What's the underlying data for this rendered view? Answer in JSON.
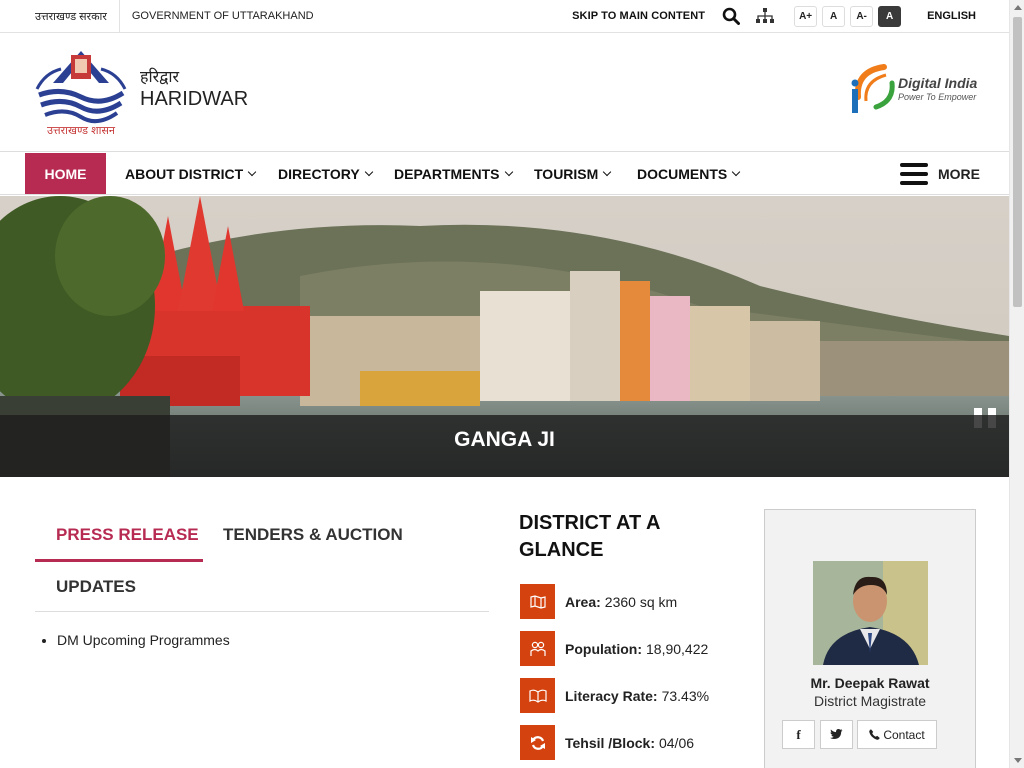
{
  "topbar": {
    "gov_hindi": "उत्तराखण्ड सरकार",
    "gov_english": "GOVERNMENT OF UTTARAKHAND",
    "skip_link": "SKIP TO MAIN CONTENT",
    "font_sizes": [
      "A+",
      "A",
      "A-",
      "A"
    ],
    "language": "ENGLISH",
    "icons": [
      "search-icon",
      "sitemap-icon"
    ]
  },
  "header": {
    "emblem_caption": "उत्तराखण्ड शासन",
    "title_hindi": "हरिद्वार",
    "title_english": "HARIDWAR",
    "digital_india_title": "Digital India",
    "digital_india_tagline": "Power To Empower"
  },
  "nav": {
    "items": [
      "HOME",
      "ABOUT DISTRICT",
      "DIRECTORY",
      "DEPARTMENTS",
      "TOURISM",
      "DOCUMENTS"
    ],
    "more_label": "MORE",
    "accent": "#b72b52"
  },
  "banner": {
    "caption": "GANGA JI"
  },
  "tabs": {
    "items": [
      "PRESS RELEASE",
      "TENDERS & AUCTION",
      "UPDATES"
    ],
    "list": [
      "DM Upcoming Programmes"
    ]
  },
  "glance": {
    "title_line1": "DISTRICT AT A",
    "title_line2": "GLANCE",
    "accent": "#d4430f",
    "rows": [
      {
        "label": "Area:",
        "value": "2360 sq km",
        "icon": "map-icon"
      },
      {
        "label": "Population:",
        "value": "18,90,422",
        "icon": "people-icon"
      },
      {
        "label": "Literacy Rate:",
        "value": "73.43%",
        "icon": "book-icon"
      },
      {
        "label": "Tehsil /Block:",
        "value": "04/06",
        "icon": "refresh-icon"
      }
    ]
  },
  "profile": {
    "name": "Mr. Deepak Rawat",
    "role": "District Magistrate",
    "facebook_glyph": "f",
    "contact_label": "Contact"
  }
}
